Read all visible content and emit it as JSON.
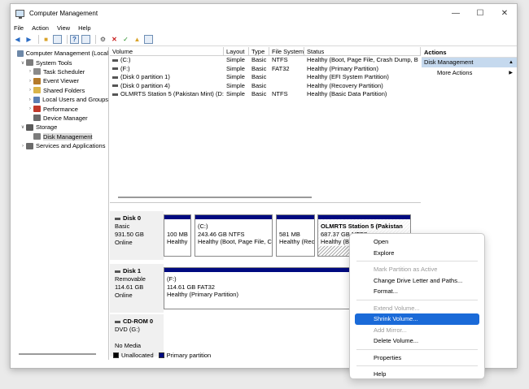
{
  "window": {
    "title": "Computer Management",
    "minimize": "—",
    "maximize": "☐",
    "close": "✕"
  },
  "menu": [
    "File",
    "Action",
    "View",
    "Help"
  ],
  "toolbar": {
    "icons": [
      "back-arrow-icon",
      "forward-arrow-icon",
      "folder-icon",
      "console-tree-icon",
      "help-icon",
      "properties-icon",
      "settings-icon",
      "delete-icon",
      "check-icon",
      "export-icon",
      "pane-icon"
    ]
  },
  "tree": {
    "items": [
      {
        "label": "Computer Management (Local",
        "level": 0,
        "arrow": "",
        "color": "#6d88a8"
      },
      {
        "label": "System Tools",
        "level": 1,
        "arrow": "∨",
        "color": "#7c7c7c"
      },
      {
        "label": "Task Scheduler",
        "level": 2,
        "arrow": "›",
        "color": "#8a8a8a"
      },
      {
        "label": "Event Viewer",
        "level": 2,
        "arrow": "›",
        "color": "#b47a2a"
      },
      {
        "label": "Shared Folders",
        "level": 2,
        "arrow": "›",
        "color": "#d9b44a"
      },
      {
        "label": "Local Users and Groups",
        "level": 2,
        "arrow": "›",
        "color": "#5b7fb4"
      },
      {
        "label": "Performance",
        "level": 2,
        "arrow": "›",
        "color": "#c0392b"
      },
      {
        "label": "Device Manager",
        "level": 2,
        "arrow": "",
        "color": "#6a6a6a"
      },
      {
        "label": "Storage",
        "level": 1,
        "arrow": "∨",
        "color": "#5a5a5a"
      },
      {
        "label": "Disk Management",
        "level": 2,
        "arrow": "",
        "color": "#7d7d7d",
        "selected": true
      },
      {
        "label": "Services and Applications",
        "level": 1,
        "arrow": "›",
        "color": "#6b6b6b"
      }
    ]
  },
  "volumes": {
    "headers": [
      "Volume",
      "Layout",
      "Type",
      "File System",
      "Status"
    ],
    "rows": [
      [
        "(C:)",
        "Simple",
        "Basic",
        "NTFS",
        "Healthy (Boot, Page File, Crash Dump, B"
      ],
      [
        "(F:)",
        "Simple",
        "Basic",
        "FAT32",
        "Healthy (Primary Partition)"
      ],
      [
        "(Disk 0 partition 1)",
        "Simple",
        "Basic",
        "",
        "Healthy (EFI System Partition)"
      ],
      [
        "(Disk 0 partition 4)",
        "Simple",
        "Basic",
        "",
        "Healthy (Recovery Partition)"
      ],
      [
        "OLMRTS Station 5 (Pakistan Mint) (D:)",
        "Simple",
        "Basic",
        "NTFS",
        "Healthy (Basic Data Partition)"
      ]
    ]
  },
  "disks": [
    {
      "name": "Disk 0",
      "info": [
        "Basic",
        "931.50 GB",
        "Online"
      ],
      "partitions": [
        {
          "lines": [
            "",
            "100 MB",
            "Healthy"
          ]
        },
        {
          "lines": [
            "(C:)",
            "243.46 GB NTFS",
            "Healthy (Boot, Page File, C"
          ]
        },
        {
          "lines": [
            "",
            "581 MB",
            "Healthy (Rec"
          ]
        },
        {
          "lines": [
            "OLMRTS Station 5 (Pakistan",
            "687.37 GB NTFS",
            "Healthy (B"
          ]
        }
      ]
    },
    {
      "name": "Disk 1",
      "info": [
        "Removable",
        "114.61 GB",
        "Online"
      ],
      "partitions": [
        {
          "lines": [
            "(F:)",
            "114.61 GB FAT32",
            "Healthy (Primary Partition)"
          ]
        }
      ]
    },
    {
      "name": "CD-ROM 0",
      "info": [
        "DVD (G:)",
        "",
        "No Media"
      ],
      "partitions": []
    }
  ],
  "legend": [
    {
      "label": "Unallocated",
      "color": "#000000"
    },
    {
      "label": "Primary partition",
      "color": "#000a80"
    }
  ],
  "actions": {
    "header": "Actions",
    "section": "Disk Management",
    "section_arrow": "▲",
    "items": [
      {
        "label": "More Actions",
        "arrow": "▶"
      }
    ]
  },
  "context_menu": {
    "groups": [
      [
        {
          "label": "Open"
        },
        {
          "label": "Explore"
        }
      ],
      [
        {
          "label": "Mark Partition as Active",
          "disabled": true
        },
        {
          "label": "Change Drive Letter and Paths..."
        },
        {
          "label": "Format..."
        }
      ],
      [
        {
          "label": "Extend Volume...",
          "disabled": true
        },
        {
          "label": "Shrink Volume...",
          "highlight": true
        },
        {
          "label": "Add Mirror...",
          "disabled": true
        },
        {
          "label": "Delete Volume..."
        }
      ],
      [
        {
          "label": "Properties"
        }
      ],
      [
        {
          "label": "Help"
        }
      ]
    ]
  }
}
